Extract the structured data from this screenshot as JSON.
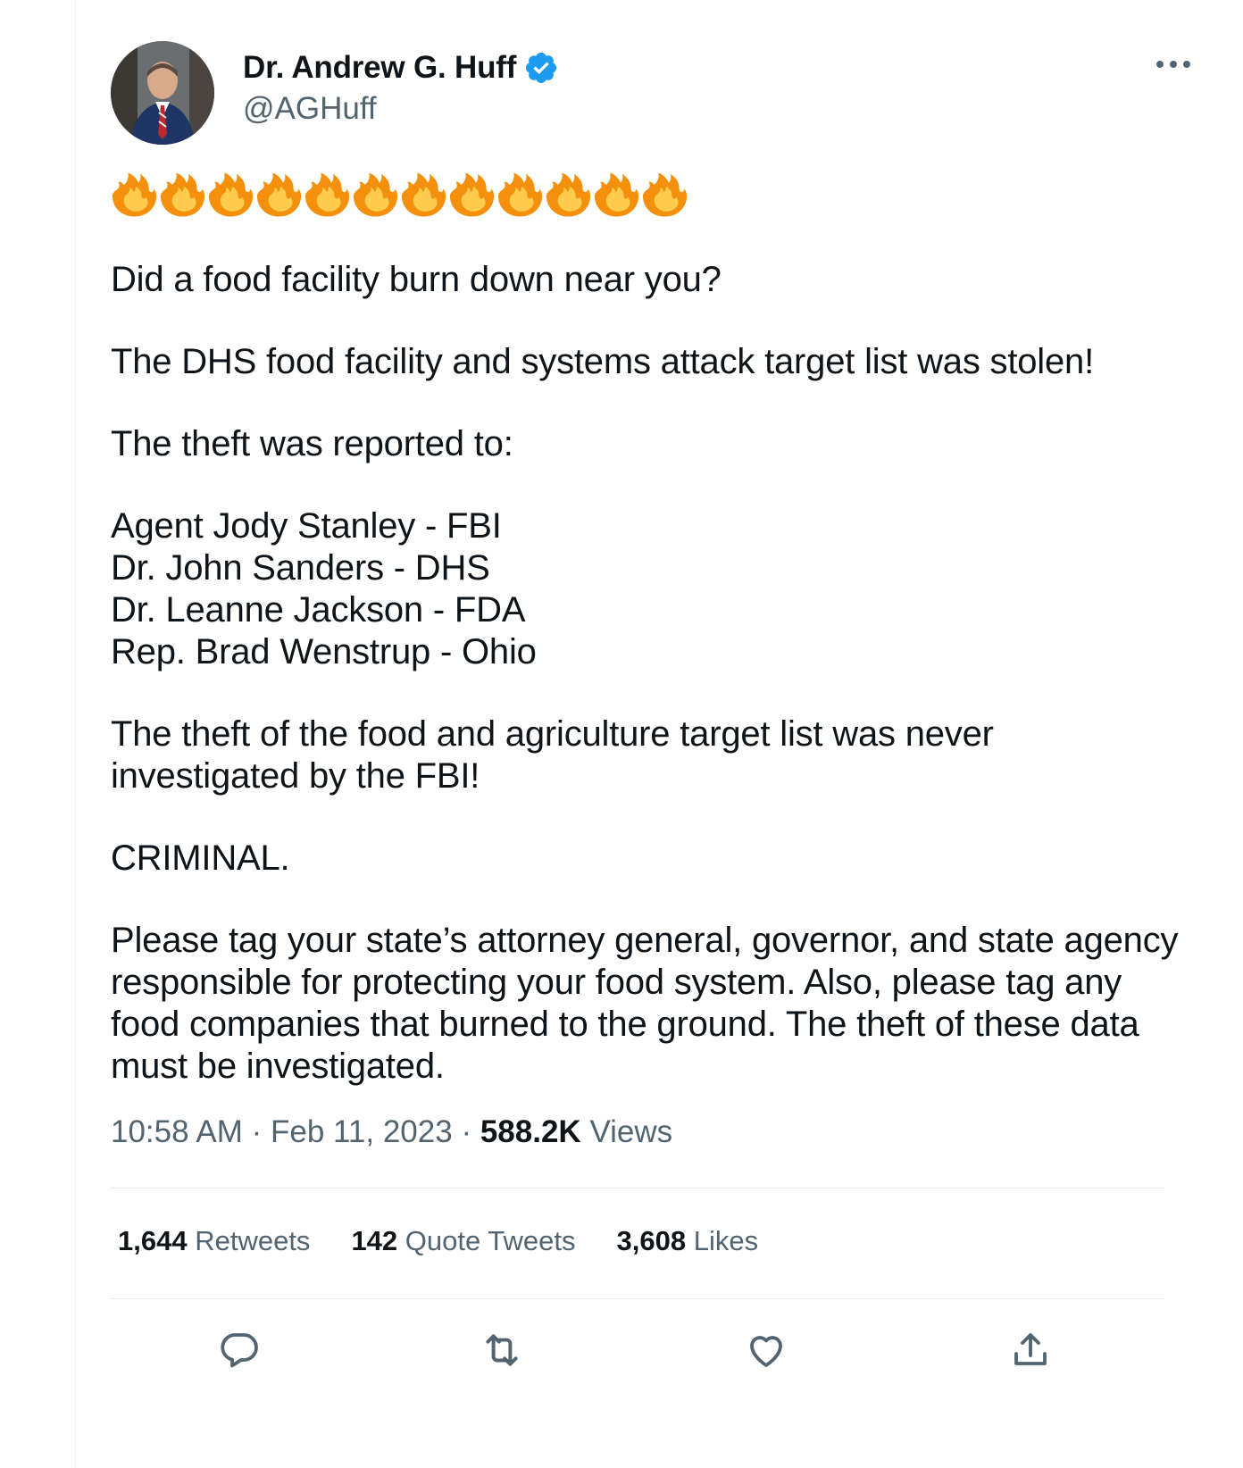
{
  "author": {
    "display_name": "Dr. Andrew G. Huff",
    "handle": "@AGHuff",
    "verified": true
  },
  "tweet": {
    "emoji_count": 12,
    "emoji": "fire",
    "paragraphs": [
      "Did a food facility burn down near you?",
      "The DHS food facility and systems attack target list was stolen!",
      "The theft was reported to:",
      "Agent Jody Stanley - FBI\nDr. John Sanders - DHS\nDr. Leanne Jackson - FDA\nRep. Brad Wenstrup - Ohio",
      "The theft of the food and agriculture target list was never investigated by the FBI!",
      "CRIMINAL.",
      "Please tag your state’s attorney general, governor, and state agency responsible for protecting your food system. Also, please tag any food companies that burned to the ground. The theft of these data must be investigated."
    ],
    "time": "10:58 AM",
    "date": "Feb 11, 2023",
    "views_count": "588.2K",
    "views_label": "Views",
    "separator": "·"
  },
  "stats": {
    "retweets_count": "1,644",
    "retweets_label": "Retweets",
    "quotes_count": "142",
    "quotes_label": "Quote Tweets",
    "likes_count": "3,608",
    "likes_label": "Likes"
  },
  "colors": {
    "verified": "#1d9bf0",
    "secondary_text": "#536471",
    "primary_text": "#0f1419",
    "fire_outer": "#f4900c",
    "fire_inner": "#ffcc4d"
  }
}
